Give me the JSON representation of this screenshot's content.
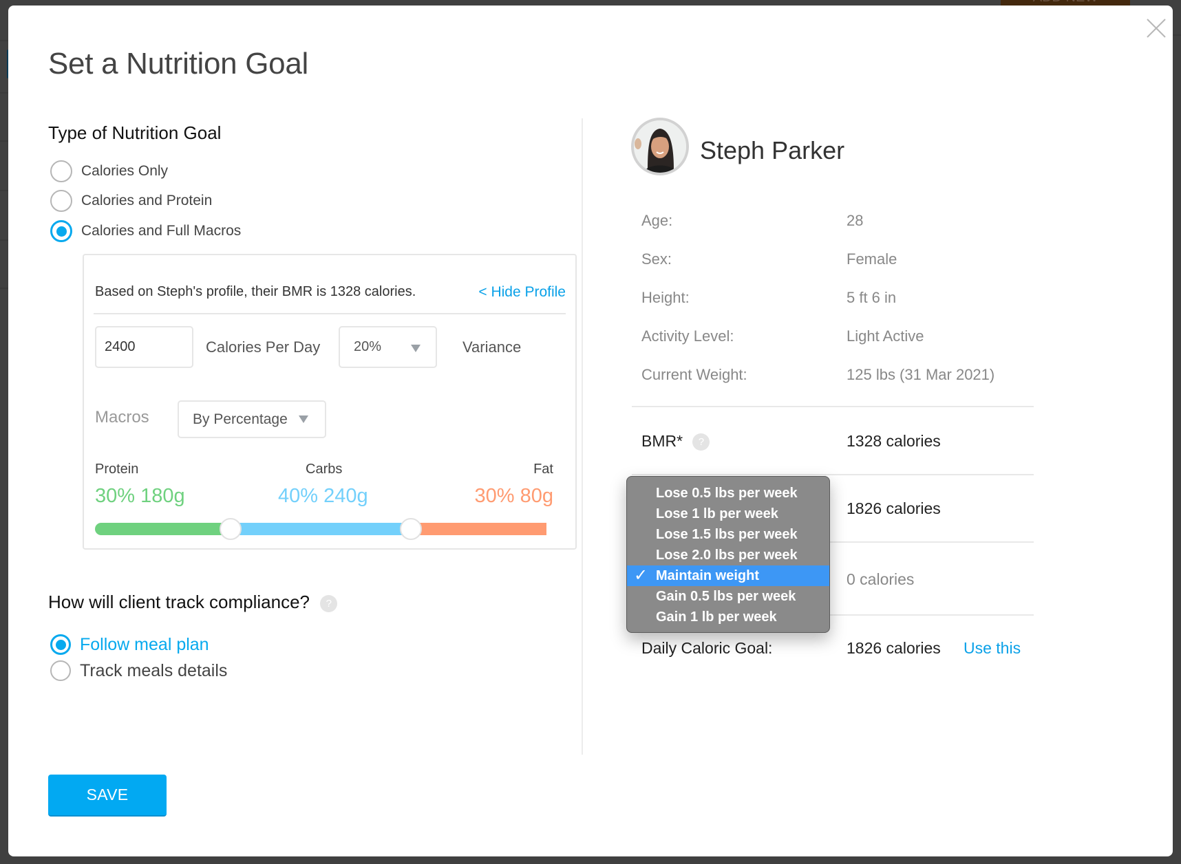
{
  "background": {
    "add_new_label": "ADD NEW"
  },
  "modal": {
    "title": "Set a Nutrition Goal",
    "close_icon": "close-x-icon"
  },
  "goal_type": {
    "heading": "Type of Nutrition Goal",
    "options": [
      {
        "label": "Calories Only",
        "checked": false
      },
      {
        "label": "Calories and Protein",
        "checked": false
      },
      {
        "label": "Calories and Full Macros",
        "checked": true
      }
    ]
  },
  "macros_card": {
    "bmr_text": "Based on Steph's profile, their BMR is 1328 calories.",
    "hide_profile_link": "< Hide Profile",
    "calories_value": "2400",
    "calories_label": "Calories Per Day",
    "variance_value": "20%",
    "variance_label": "Variance",
    "macros_label": "Macros",
    "macros_mode": "By Percentage",
    "macros": [
      {
        "name": "Protein",
        "value": "30% 180g",
        "percent": 30,
        "color": "#6fd17f"
      },
      {
        "name": "Carbs",
        "value": "40% 240g",
        "percent": 40,
        "color": "#73d0fb"
      },
      {
        "name": "Fat",
        "value": "30% 80g",
        "percent": 30,
        "color": "#ff9b71"
      }
    ]
  },
  "compliance": {
    "heading": "How will client track compliance?",
    "help_icon": "?",
    "options": [
      {
        "label": "Follow meal plan",
        "checked": true
      },
      {
        "label": "Track meals details",
        "checked": false
      }
    ]
  },
  "save_label": "SAVE",
  "profile": {
    "name": "Steph Parker",
    "fields": [
      {
        "label": "Age:",
        "value": "28"
      },
      {
        "label": "Sex:",
        "value": "Female"
      },
      {
        "label": "Height:",
        "value": "5 ft 6 in"
      },
      {
        "label": "Activity Level:",
        "value": "Light Active"
      },
      {
        "label": "Current Weight:",
        "value": "125 lbs (31 Mar 2021)"
      }
    ]
  },
  "calculation": {
    "bmr_label": "BMR*",
    "bmr_help": "?",
    "bmr_value": "1328 calories",
    "row2_value": "1826 calories",
    "row3_value": "0 calories",
    "daily_goal_label": "Daily Caloric Goal:",
    "daily_goal_value": "1826 calories",
    "use_this_label": "Use this"
  },
  "weight_goal_popup": {
    "check_glyph": "✓",
    "options": [
      {
        "label": "Lose 0.5 lbs per week",
        "selected": false
      },
      {
        "label": "Lose 1 lb per week",
        "selected": false
      },
      {
        "label": "Lose 1.5 lbs per week",
        "selected": false
      },
      {
        "label": "Lose 2.0 lbs per week",
        "selected": false
      },
      {
        "label": "Maintain weight",
        "selected": true
      },
      {
        "label": "Gain 0.5 lbs per week",
        "selected": false
      },
      {
        "label": "Gain 1 lb per week",
        "selected": false
      }
    ]
  },
  "colors": {
    "accent": "#06a9ee",
    "save_button": "#02a9f2",
    "popup_bg": "#8a8a8a",
    "popup_selected": "#3d97f5"
  }
}
